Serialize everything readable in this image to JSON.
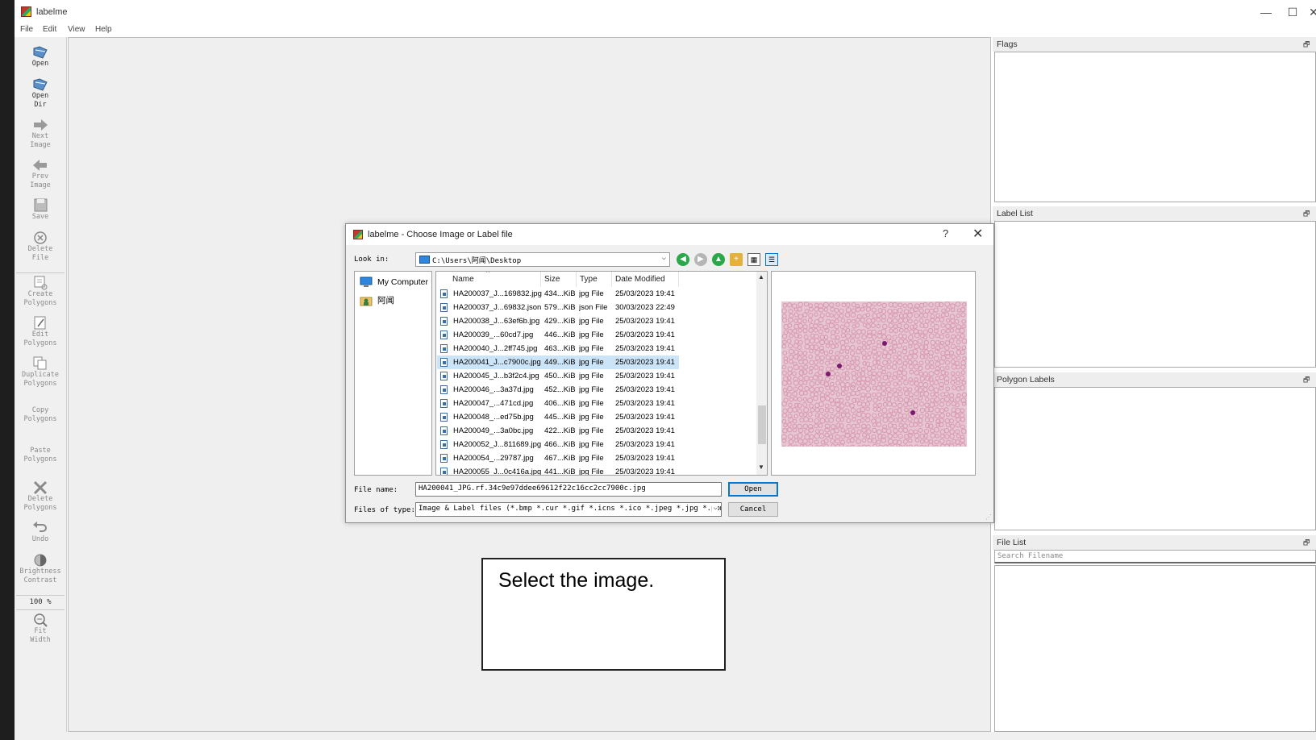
{
  "app": {
    "title": "labelme",
    "window_controls": {
      "minimize": "—",
      "maximize": "☐",
      "close": "✕"
    }
  },
  "menu": [
    "File",
    "Edit",
    "View",
    "Help"
  ],
  "toolbar": {
    "items": [
      {
        "label": "Open",
        "icon": "folder-open-icon"
      },
      {
        "label": "Open\nDir",
        "icon": "folder-open-dir-icon"
      },
      {
        "label": "Next\nImage",
        "icon": "arrow-right-icon"
      },
      {
        "label": "Prev\nImage",
        "icon": "arrow-left-icon"
      },
      {
        "label": "Save",
        "icon": "save-icon"
      },
      {
        "label": "Delete\nFile",
        "icon": "delete-circle-icon"
      },
      {
        "label": "Create\nPolygons",
        "icon": "create-polygon-icon"
      },
      {
        "label": "Edit\nPolygons",
        "icon": "edit-polygon-icon"
      },
      {
        "label": "Duplicate\nPolygons",
        "icon": "duplicate-icon"
      },
      {
        "label": "Copy\nPolygons",
        "icon": ""
      },
      {
        "label": "Paste\nPolygons",
        "icon": ""
      },
      {
        "label": "Delete\nPolygons",
        "icon": "delete-x-icon"
      },
      {
        "label": "Undo",
        "icon": "undo-icon"
      },
      {
        "label": "Brightness\nContrast",
        "icon": "brightness-icon"
      },
      {
        "label": "Fit\nWidth",
        "icon": "zoom-fit-icon"
      }
    ],
    "zoom": "100 %"
  },
  "docks": {
    "flags": "Flags",
    "label_list": "Label List",
    "polygon_labels": "Polygon Labels",
    "file_list": "File List",
    "search_placeholder": "Search Filename",
    "float_glyph": "🗗"
  },
  "dialog": {
    "title": "labelme - Choose Image or Label file",
    "help": "?",
    "close": "✕",
    "look_in_label": "Look in:",
    "look_in_value": "C:\\Users\\阿闻\\Desktop",
    "sidebar": [
      {
        "label": "My Computer",
        "icon": "computer-icon"
      },
      {
        "label": "阿闻",
        "icon": "user-folder-icon"
      }
    ],
    "columns": [
      "Name",
      "Size",
      "Type",
      "Date Modified"
    ],
    "files": [
      {
        "name": "HA200037_J...169832.jpg",
        "size": "434...KiB",
        "type": "jpg File",
        "date": "25/03/2023 19:41"
      },
      {
        "name": "HA200037_J...69832.json",
        "size": "579...KiB",
        "type": "json File",
        "date": "30/03/2023 22:49"
      },
      {
        "name": "HA200038_J...63ef6b.jpg",
        "size": "429...KiB",
        "type": "jpg File",
        "date": "25/03/2023 19:41"
      },
      {
        "name": "HA200039_...60cd7.jpg",
        "size": "446...KiB",
        "type": "jpg File",
        "date": "25/03/2023 19:41"
      },
      {
        "name": "HA200040_J...2ff745.jpg",
        "size": "463...KiB",
        "type": "jpg File",
        "date": "25/03/2023 19:41"
      },
      {
        "name": "HA200041_J...c7900c.jpg",
        "size": "449...KiB",
        "type": "jpg File",
        "date": "25/03/2023 19:41"
      },
      {
        "name": "HA200045_J...b3f2c4.jpg",
        "size": "450...KiB",
        "type": "jpg File",
        "date": "25/03/2023 19:41"
      },
      {
        "name": "HA200046_...3a37d.jpg",
        "size": "452...KiB",
        "type": "jpg File",
        "date": "25/03/2023 19:41"
      },
      {
        "name": "HA200047_...471cd.jpg",
        "size": "406...KiB",
        "type": "jpg File",
        "date": "25/03/2023 19:41"
      },
      {
        "name": "HA200048_...ed75b.jpg",
        "size": "445...KiB",
        "type": "jpg File",
        "date": "25/03/2023 19:41"
      },
      {
        "name": "HA200049_...3a0bc.jpg",
        "size": "422...KiB",
        "type": "jpg File",
        "date": "25/03/2023 19:41"
      },
      {
        "name": "HA200052_J...811689.jpg",
        "size": "466...KiB",
        "type": "jpg File",
        "date": "25/03/2023 19:41"
      },
      {
        "name": "HA200054_...29787.jpg",
        "size": "467...KiB",
        "type": "jpg File",
        "date": "25/03/2023 19:41"
      },
      {
        "name": "HA200055_J...0c416a.jpg",
        "size": "441...KiB",
        "type": "jpg File",
        "date": "25/03/2023 19:41"
      }
    ],
    "selected_index": 5,
    "file_name_label": "File name:",
    "file_name_value": "HA200041_JPG.rf.34c9e97ddee69612f22c16cc2cc7900c.jpg",
    "files_of_type_label": "Files of type:",
    "files_of_type_value": "Image & Label files (*.bmp *.cur *.gif *.icns *.ico *.jpeg *.jpg *.pbm",
    "open_button": "Open",
    "cancel_button": "Cancel"
  },
  "note": "Select the image.",
  "colors": {
    "selection": "#cce4f7",
    "default_button_border": "#0078d7",
    "cell_color": "#d99ab0",
    "parasite_color": "#7a1a6e"
  }
}
